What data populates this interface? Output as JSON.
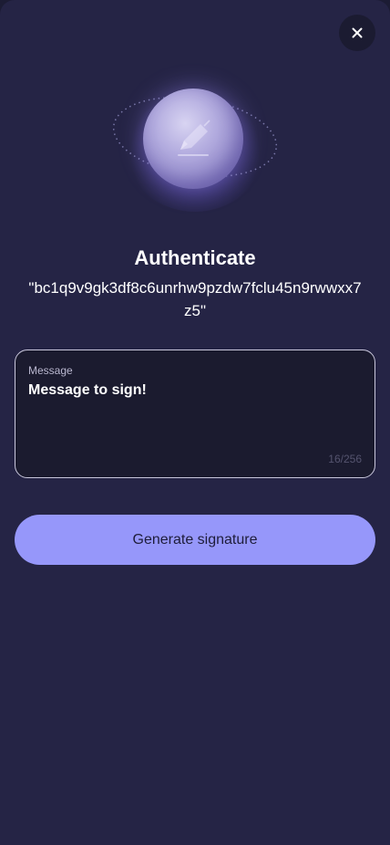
{
  "header": {
    "close_icon": "close-icon"
  },
  "hero": {
    "icon": "pencil-sign-icon",
    "accent_color": "#9697fa"
  },
  "title": "Authenticate",
  "address": "\"bc1q9v9gk3df8c6unrhw9pzdw7fclu45n9rwwxx7z5\"",
  "message_field": {
    "label": "Message",
    "value": "Message to sign!",
    "counter": "16/256"
  },
  "actions": {
    "generate_label": "Generate signature"
  },
  "colors": {
    "background": "#252445",
    "button": "#9697fa",
    "field_bg": "#1b1b2f"
  }
}
